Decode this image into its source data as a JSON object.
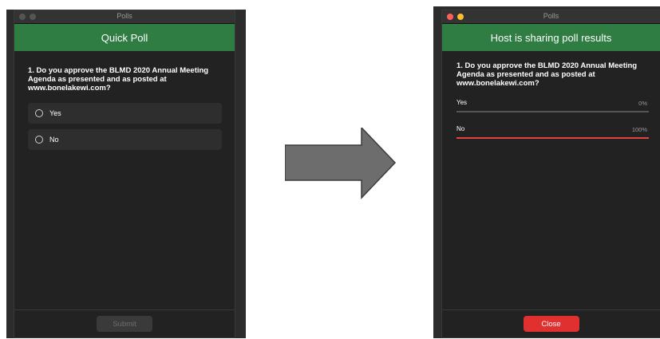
{
  "left_window": {
    "title": "Polls",
    "header": "Quick Poll",
    "question": "1. Do you approve the BLMD 2020 Annual Meeting Agenda as presented and as posted at www.bonelakewi.com?",
    "options": [
      {
        "label": "Yes",
        "selected": false
      },
      {
        "label": "No",
        "selected": false
      }
    ],
    "submit_label": "Submit"
  },
  "right_window": {
    "title": "Polls",
    "header": "Host is sharing poll results",
    "question": "1. Do you approve the BLMD 2020 Annual Meeting Agenda as presented and as posted at www.bonelakewi.com?",
    "results": [
      {
        "label": "Yes",
        "percent": "0%",
        "fraction": 0
      },
      {
        "label": "No",
        "percent": "100%",
        "fraction": 1
      }
    ],
    "close_label": "Close"
  },
  "colors": {
    "header_green": "#2f7d42",
    "close_red": "#e0302f",
    "result_bar": "#e0453f",
    "window_bg": "#222222"
  },
  "icons": {
    "arrow": "right-arrow-icon"
  }
}
